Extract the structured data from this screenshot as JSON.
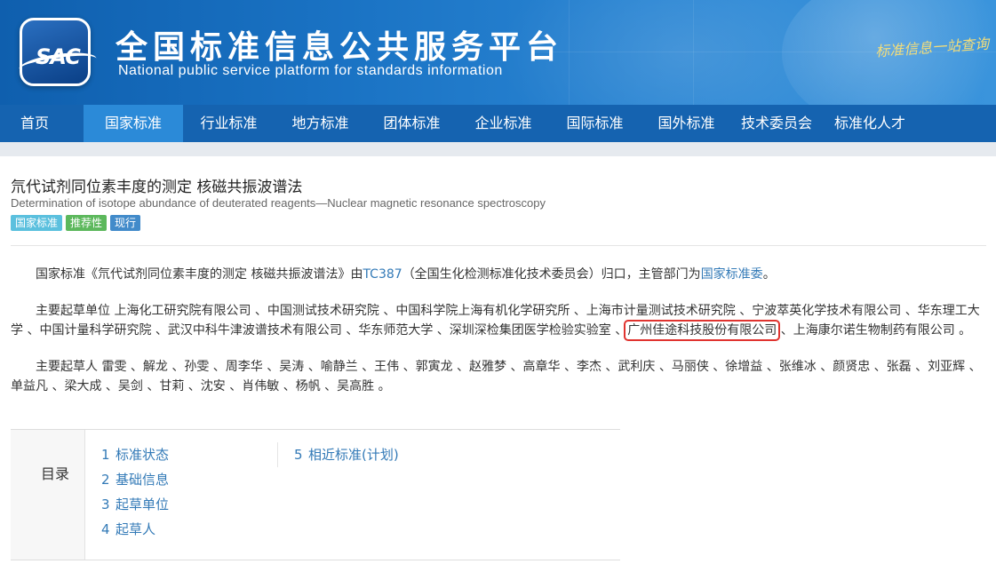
{
  "header": {
    "logo_text": "SAC",
    "title": "全国标准信息公共服务平台",
    "subtitle": "National public service platform  for standards information",
    "slogan": "标准信息一站查询"
  },
  "nav": {
    "items": [
      {
        "label": "首页",
        "active": false
      },
      {
        "label": "国家标准",
        "active": true
      },
      {
        "label": "行业标准",
        "active": false
      },
      {
        "label": "地方标准",
        "active": false
      },
      {
        "label": "团体标准",
        "active": false
      },
      {
        "label": "企业标准",
        "active": false
      },
      {
        "label": "国际标准",
        "active": false
      },
      {
        "label": "国外标准",
        "active": false
      },
      {
        "label": "技术委员会",
        "active": false
      },
      {
        "label": "标准化人才",
        "active": false
      }
    ]
  },
  "standard": {
    "title_cn": "氘代试剂同位素丰度的测定 核磁共振波谱法",
    "title_en": "Determination of isotope abundance of deuterated reagents—Nuclear magnetic resonance spectroscopy",
    "badges": [
      "国家标准",
      "推荐性",
      "现行"
    ]
  },
  "intro": {
    "prefix": "国家标准《氘代试剂同位素丰度的测定 核磁共振波谱法》由",
    "tc_link": "TC387",
    "middle": "（全国生化检测标准化技术委员会）归口，主管部门为",
    "dept_link": "国家标准委",
    "suffix": "。"
  },
  "drafting_units": {
    "prefix": "主要起草单位 上海化工研究院有限公司 、中国测试技术研究院 、中国科学院上海有机化学研究所 、上海市计量测试技术研究院 、宁波萃英化学技术有限公司 、华东理工大学 、中国计量科学研究院 、武汉中科牛津波谱技术有限公司 、华东师范大学 、深圳深检集团医学检验实验室 、",
    "highlighted": "广州佳途科技股份有限公司",
    "suffix": " 、上海康尔诺生物制药有限公司 。"
  },
  "drafters": {
    "text": "主要起草人 雷雯 、解龙 、孙雯 、周李华 、吴涛 、喻静兰 、王伟 、郭寅龙 、赵雅梦 、高章华 、李杰 、武利庆 、马丽侠 、徐增益 、张维冰 、颜贤忠 、张磊 、刘亚辉 、单益凡 、梁大成 、吴剑 、甘莉 、沈安 、肖伟敏 、杨帆 、吴高胜 。"
  },
  "toc": {
    "label": "目录",
    "col1": [
      {
        "num": "1",
        "label": "标准状态"
      },
      {
        "num": "2",
        "label": "基础信息"
      },
      {
        "num": "3",
        "label": "起草单位"
      },
      {
        "num": "4",
        "label": "起草人"
      }
    ],
    "col2": [
      {
        "num": "5",
        "label": "相近标准(计划)"
      }
    ]
  },
  "colors": {
    "nav_bg": "#1563b0",
    "nav_active": "#2b8ad8",
    "link": "#337ab7",
    "highlight_border": "#e0332f"
  }
}
